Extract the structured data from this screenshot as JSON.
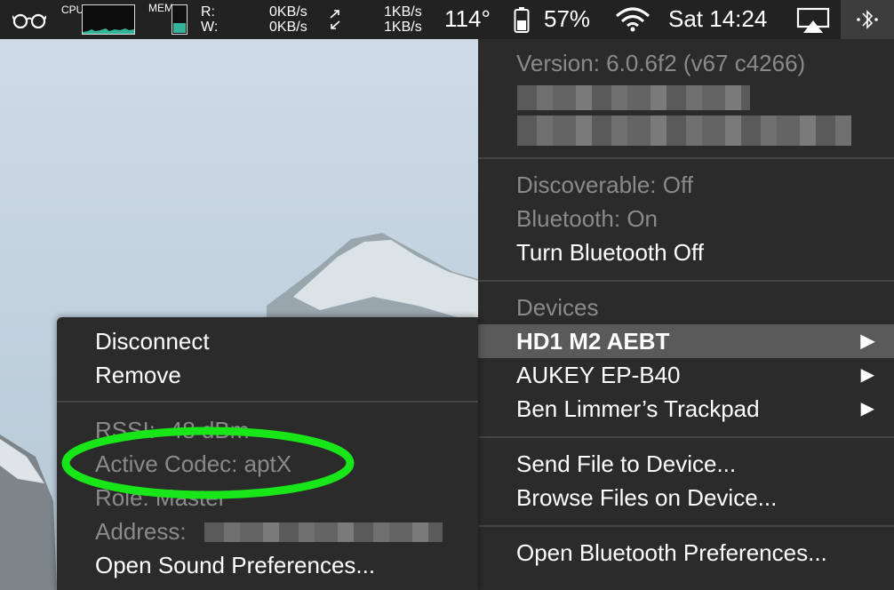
{
  "menubar": {
    "cpu_label": "CPU",
    "mem_label": "MEM",
    "read_label": "R:",
    "write_label": "W:",
    "net_up": "0KB/s",
    "net_down": "0KB/s",
    "disk_read": "1KB/s",
    "disk_write": "1KB/s",
    "temperature": "114°",
    "battery": "57%",
    "clock": "Sat 14:24",
    "memory_used_fraction": 0.35
  },
  "bluetooth_menu": {
    "version": "Version: 6.0.6f2 (v67 c4266)",
    "discoverable": "Discoverable: Off",
    "bluetooth_status": "Bluetooth: On",
    "toggle": "Turn Bluetooth Off",
    "devices_header": "Devices",
    "devices": [
      {
        "name": "HD1 M2 AEBT"
      },
      {
        "name": "AUKEY EP-B40"
      },
      {
        "name": "Ben Limmer’s Trackpad"
      }
    ],
    "send_file": "Send File to Device...",
    "browse_files": "Browse Files on Device...",
    "open_prefs": "Open Bluetooth Preferences..."
  },
  "device_submenu": {
    "disconnect": "Disconnect",
    "remove": "Remove",
    "rssi": "RSSI: -48 dBm",
    "codec": "Active Codec: aptX",
    "role": "Role: Master",
    "address": "Address:",
    "open_sound_prefs": "Open Sound Preferences..."
  },
  "colors": {
    "menu_bg": "#2b2b2b",
    "highlight": "#5a5a5a",
    "annotation_ring": "#19e619",
    "mem_fill": "#33b59a"
  },
  "icons": [
    "glasses-icon",
    "cpu-graph-icon",
    "memory-gauge-icon",
    "network-arrows-icon",
    "battery-icon",
    "wifi-icon",
    "airplay-icon",
    "bluetooth-icon",
    "submenu-arrow-icon"
  ]
}
